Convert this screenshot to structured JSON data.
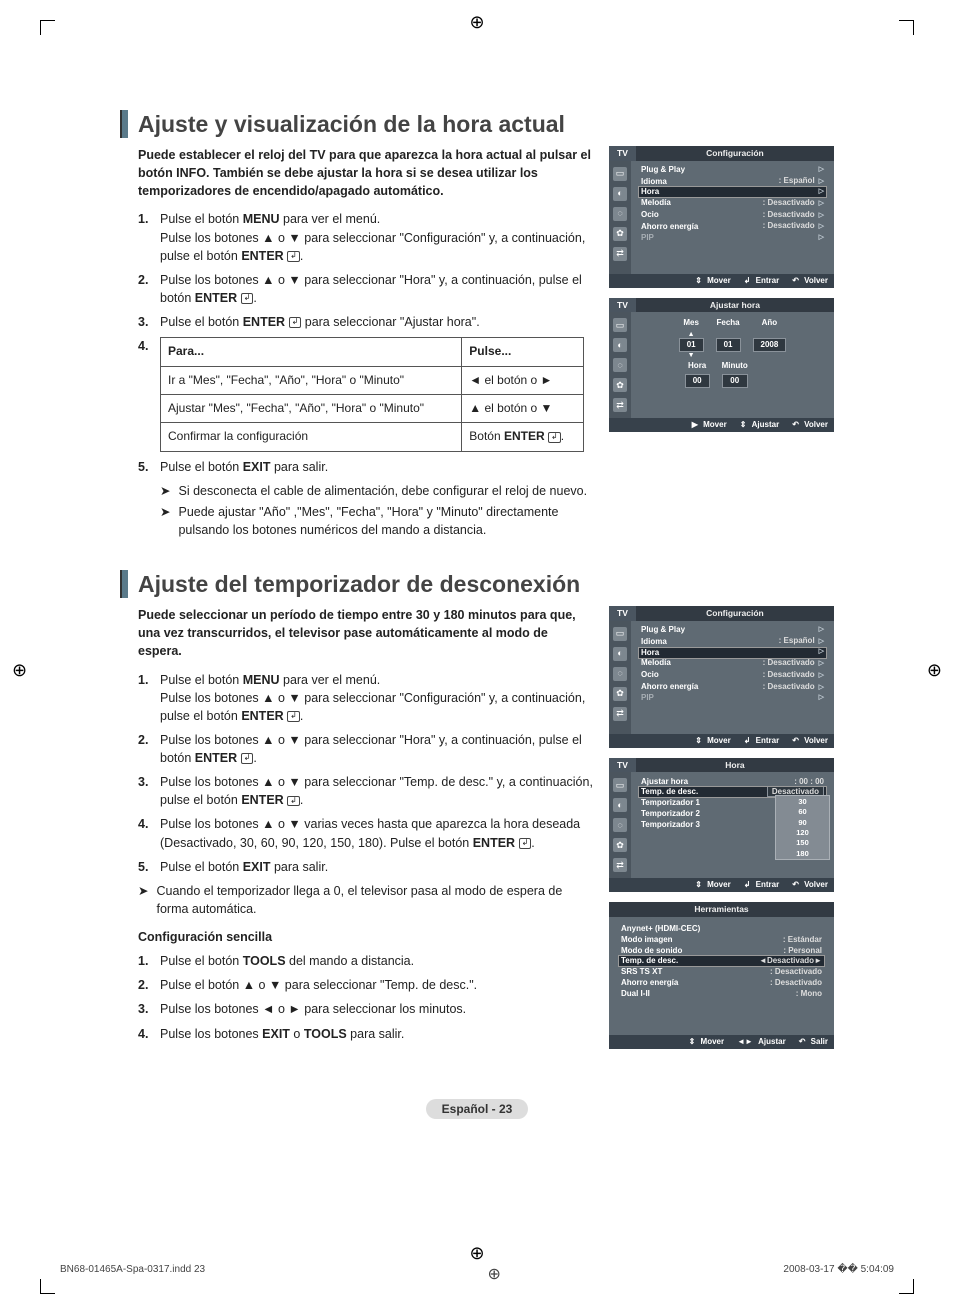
{
  "page": {
    "label": "Español - 23",
    "footer_left": "BN68-01465A-Spa-0317.indd   23",
    "footer_right": "2008-03-17   �� 5:04:09"
  },
  "section1": {
    "title": "Ajuste y visualización de la hora actual",
    "lead": "Puede establecer el reloj del TV para que aparezca la hora actual al pulsar el botón INFO. También se debe ajustar la hora si se desea utilizar los temporizadores de encendido/apagado automático.",
    "step1a": "Pulse el botón ",
    "step1b": "MENU",
    "step1c": " para ver el menú.",
    "step1d": "Pulse los botones ▲ o ▼ para seleccionar \"Configuración\" y, a continuación, pulse el botón ",
    "step1e": "ENTER",
    "step1f": ".",
    "step2a": "Pulse los botones ▲ o ▼ para seleccionar \"Hora\" y, a continuación, pulse el botón ",
    "step2b": "ENTER",
    "step2c": ".",
    "step3a": "Pulse el botón ",
    "step3b": "ENTER",
    "step3c": " para seleccionar \"Ajustar hora\".",
    "table": {
      "h1": "Para...",
      "h2": "Pulse...",
      "r1c1": "Ir a \"Mes\", \"Fecha\", \"Año\", \"Hora\" o \"Minuto\"",
      "r1c2": "◄ el botón o ►",
      "r2c1": "Ajustar \"Mes\", \"Fecha\", \"Año\", \"Hora\" o \"Minuto\"",
      "r2c2": "▲ el botón o ▼",
      "r3c1": "Confirmar la configuración",
      "r3c2a": "Botón ",
      "r3c2b": "ENTER",
      "r3c2c": "."
    },
    "step5a": "Pulse el botón ",
    "step5b": "EXIT",
    "step5c": " para salir.",
    "note1": "Si desconecta el cable de alimentación, debe configurar el reloj de nuevo.",
    "note2": "Puede ajustar \"Año\" ,\"Mes\", \"Fecha\", \"Hora\" y \"Minuto\" directamente pulsando los botones numéricos del mando a distancia."
  },
  "section2": {
    "title": "Ajuste del temporizador de desconexión",
    "lead": "Puede seleccionar un período de tiempo entre 30 y 180 minutos para que, una vez transcurridos, el televisor pase automáticamente al modo de espera.",
    "s1a": "Pulse el botón ",
    "s1b": "MENU",
    "s1c": " para ver el menú.",
    "s1d": "Pulse los botones ▲ o ▼ para seleccionar \"Configuración\" y, a continuación, pulse el botón ",
    "s1e": "ENTER",
    "s1f": ".",
    "s2a": "Pulse los botones ▲ o ▼ para seleccionar \"Hora\" y, a continuación, pulse el botón ",
    "s2b": "ENTER",
    "s2c": ".",
    "s3a": "Pulse los botones ▲ o ▼ para seleccionar \"Temp. de desc.\" y, a continuación, pulse el botón ",
    "s3b": "ENTER",
    "s3c": ".",
    "s4a": "Pulse los botones ▲ o ▼ varias veces hasta que aparezca la hora deseada (Desactivado, 30, 60, 90, 120, 150, 180). Pulse el botón ",
    "s4b": "ENTER",
    "s4c": ".",
    "s5a": "Pulse el botón ",
    "s5b": "EXIT",
    "s5c": " para salir.",
    "note": "Cuando el temporizador llega a 0, el televisor pasa al modo de espera de forma automática.",
    "easy_h": "Configuración sencilla",
    "e1a": "Pulse el botón ",
    "e1b": "TOOLS",
    "e1c": " del mando a distancia.",
    "e2": "Pulse el botón ▲ o ▼ para seleccionar \"Temp. de desc.\".",
    "e3": "Pulse los botones ◄ o ► para seleccionar los minutos.",
    "e4a": "Pulse los botones ",
    "e4b": "EXIT",
    "e4c": " o ",
    "e4d": "TOOLS",
    "e4e": " para salir."
  },
  "osd1": {
    "tv": "TV",
    "title": "Configuración",
    "r1": "Plug & Play",
    "r2": "Idioma",
    "v2": ": Español",
    "r3": "Hora",
    "r4": "Melodía",
    "v4": ": Desactivado",
    "r5": "Ocio",
    "v5": ": Desactivado",
    "r6": "Ahorro energía",
    "v6": ": Desactivado",
    "r7": "PIP",
    "f1": "Mover",
    "f2": "Entrar",
    "f3": "Volver"
  },
  "osd2": {
    "tv": "TV",
    "title": "Ajustar hora",
    "mes": "Mes",
    "fecha": "Fecha",
    "ano": "Año",
    "hora": "Hora",
    "min": "Minuto",
    "v_mes": "01",
    "v_fecha": "01",
    "v_ano": "2008",
    "v_hora": "00",
    "v_min": "00",
    "f1": "Mover",
    "f2": "Ajustar",
    "f3": "Volver"
  },
  "osd3": {
    "tv": "TV",
    "title": "Configuración",
    "r1": "Plug & Play",
    "r2": "Idioma",
    "v2": ": Español",
    "r3": "Hora",
    "r4": "Melodía",
    "v4": ": Desactivado",
    "r5": "Ocio",
    "v5": ": Desactivado",
    "r6": "Ahorro energía",
    "v6": ": Desactivado",
    "r7": "PIP",
    "f1": "Mover",
    "f2": "Entrar",
    "f3": "Volver"
  },
  "osd4": {
    "tv": "TV",
    "title": "Hora",
    "r1": "Ajustar hora",
    "v1": ": 00 : 00",
    "r2": "Temp. de desc.",
    "v2": "Desactivado",
    "r3": "Temporizador 1",
    "r4": "Temporizador 2",
    "r5": "Temporizador 3",
    "opt1": "30",
    "opt2": "60",
    "opt3": "90",
    "opt4": "120",
    "opt5": "150",
    "opt6": "180",
    "f1": "Mover",
    "f2": "Entrar",
    "f3": "Volver"
  },
  "osd5": {
    "title": "Herramientas",
    "r1": "Anynet+ (HDMI-CEC)",
    "r2": "Modo imagen",
    "v2": ": Estándar",
    "r3": "Modo de sonido",
    "v3": ": Personal",
    "r4": "Temp. de desc.",
    "v4": "Desactivado",
    "r5": "SRS TS XT",
    "v5": ": Desactivado",
    "r6": "Ahorro energía",
    "v6": ": Desactivado",
    "r7": "Dual I-II",
    "v7": ": Mono",
    "f1": "Mover",
    "f2": "Ajustar",
    "f3": "Salir"
  }
}
